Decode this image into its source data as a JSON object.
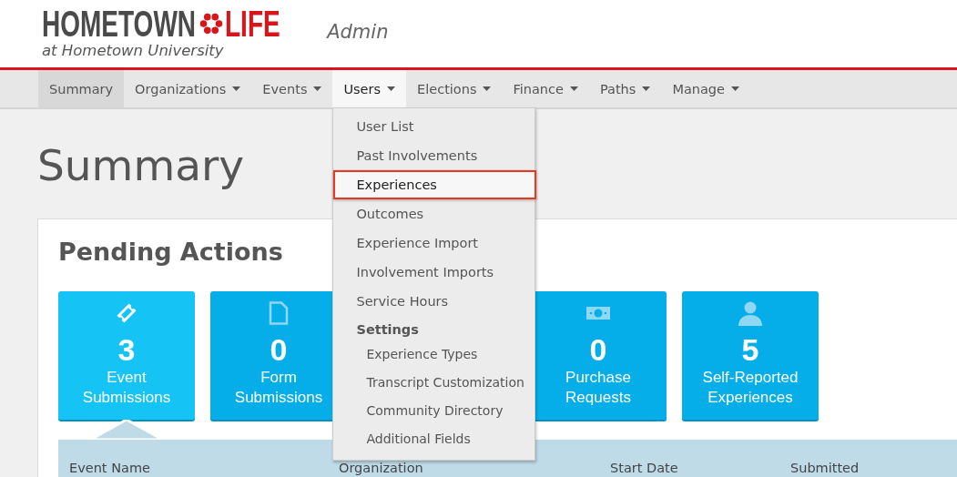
{
  "header": {
    "logo_left": "HOMETOWN",
    "logo_right": "LIFE",
    "logo_subtitle": "at Hometown University",
    "app_label": "Admin"
  },
  "nav": [
    {
      "label": "Summary",
      "selected": true,
      "dropdown": false,
      "open": false
    },
    {
      "label": "Organizations",
      "selected": false,
      "dropdown": true,
      "open": false
    },
    {
      "label": "Events",
      "selected": false,
      "dropdown": true,
      "open": false
    },
    {
      "label": "Users",
      "selected": false,
      "dropdown": true,
      "open": true
    },
    {
      "label": "Elections",
      "selected": false,
      "dropdown": true,
      "open": false
    },
    {
      "label": "Finance",
      "selected": false,
      "dropdown": true,
      "open": false
    },
    {
      "label": "Paths",
      "selected": false,
      "dropdown": true,
      "open": false
    },
    {
      "label": "Manage",
      "selected": false,
      "dropdown": true,
      "open": false
    }
  ],
  "users_menu": [
    {
      "label": "User List",
      "kind": "item",
      "highlighted": false
    },
    {
      "label": "Past Involvements",
      "kind": "item",
      "highlighted": false
    },
    {
      "label": "Experiences",
      "kind": "item",
      "highlighted": true
    },
    {
      "label": "Outcomes",
      "kind": "item",
      "highlighted": false
    },
    {
      "label": "Experience Import",
      "kind": "item",
      "highlighted": false
    },
    {
      "label": "Involvement Imports",
      "kind": "item",
      "highlighted": false
    },
    {
      "label": "Service Hours",
      "kind": "item",
      "highlighted": false
    },
    {
      "label": "Settings",
      "kind": "heading",
      "highlighted": false
    },
    {
      "label": "Experience Types",
      "kind": "subitem",
      "highlighted": false
    },
    {
      "label": "Transcript Customization",
      "kind": "subitem",
      "highlighted": false
    },
    {
      "label": "Community Directory",
      "kind": "subitem",
      "highlighted": false
    },
    {
      "label": "Additional Fields",
      "kind": "subitem",
      "highlighted": false
    }
  ],
  "page_title": "Summary",
  "pending": {
    "title": "Pending Actions",
    "tiles": [
      {
        "kind": "ticket",
        "count": "3",
        "label": "Event Submissions",
        "selected": true
      },
      {
        "kind": "document",
        "count": "0",
        "label": "Form Submissions",
        "selected": false
      },
      {
        "kind": "money",
        "count": "0",
        "label": "Purchase Requests",
        "selected": false
      },
      {
        "kind": "person",
        "count": "5",
        "label": "Self-Reported Experiences",
        "selected": false
      }
    ],
    "columns": [
      "Event Name",
      "Organization",
      "Start Date",
      "Submitted"
    ]
  }
}
